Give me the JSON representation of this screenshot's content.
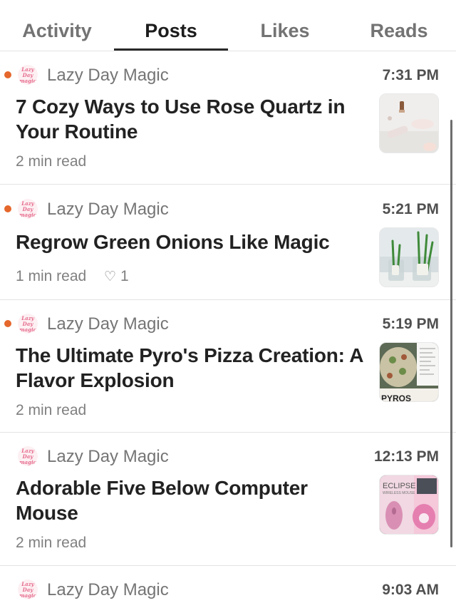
{
  "tabs": [
    {
      "label": "Activity",
      "active": false
    },
    {
      "label": "Posts",
      "active": true
    },
    {
      "label": "Likes",
      "active": false
    },
    {
      "label": "Reads",
      "active": false
    }
  ],
  "colors": {
    "unread_dot": "#e5672c",
    "accent": "#e66a8c"
  },
  "avatar_text": [
    "Lazy",
    "Day",
    "magic"
  ],
  "posts": [
    {
      "publication": "Lazy Day Magic",
      "time": "7:31 PM",
      "title": "7 Cozy Ways to Use Rose Quartz in Your Routine",
      "read_time": "2 min read",
      "likes": "",
      "unread": true,
      "thumbnail": "rose-quartz-thumbnail"
    },
    {
      "publication": "Lazy Day Magic",
      "time": "5:21 PM",
      "title": "Regrow Green Onions Like Magic",
      "read_time": "1 min read",
      "likes": "1",
      "unread": true,
      "thumbnail": "green-onions-thumbnail"
    },
    {
      "publication": "Lazy Day Magic",
      "time": "5:19 PM",
      "title": "The Ultimate Pyro's Pizza Creation: A Flavor Explosion",
      "read_time": "2 min read",
      "likes": "",
      "unread": true,
      "thumbnail": "pizza-thumbnail",
      "thumbnail_text": "PYROS"
    },
    {
      "publication": "Lazy Day Magic",
      "time": "12:13 PM",
      "title": "Adorable Five Below Computer Mouse",
      "read_time": "2 min read",
      "likes": "",
      "unread": false,
      "thumbnail": "computer-mouse-thumbnail",
      "thumbnail_text": "ECLIPSE",
      "thumbnail_subtext": "WIRELESS MOUSE"
    },
    {
      "publication": "Lazy Day Magic",
      "time": "9:03 AM",
      "unread": false
    }
  ]
}
